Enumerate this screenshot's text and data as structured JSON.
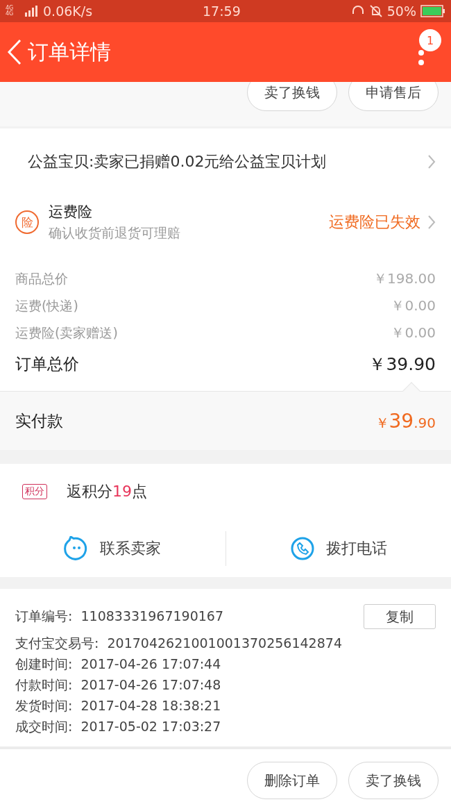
{
  "status_bar": {
    "network": "4G 4G",
    "speed": "0.06K/s",
    "time": "17:59",
    "battery": "50%"
  },
  "header": {
    "title": "订单详情",
    "badge": "1"
  },
  "top_actions": [
    "卖了换钱",
    "申请售后"
  ],
  "charity": {
    "text": "公益宝贝:卖家已捐赠0.02元给公益宝贝计划"
  },
  "insurance": {
    "icon_text": "险",
    "title": "运费险",
    "subtitle": "确认收货前退货可理赔",
    "status": "运费险已失效"
  },
  "prices": [
    {
      "label": "商品总价",
      "value": "￥198.00",
      "kind": "minor"
    },
    {
      "label": "运费(快递)",
      "value": "￥0.00",
      "kind": "minor"
    },
    {
      "label": "运费险(卖家赠送)",
      "value": "￥0.00",
      "kind": "minor"
    },
    {
      "label": "订单总价",
      "value": "￥39.90",
      "kind": "total"
    }
  ],
  "paid": {
    "label": "实付款",
    "currency": "￥",
    "integer": "39",
    "decimal": ".90"
  },
  "points": {
    "tag": "积分",
    "text": "返积分**19**点"
  },
  "contacts": [
    {
      "label": "联系卖家",
      "kind": "chat"
    },
    {
      "label": "拨打电话",
      "kind": "phone"
    }
  ],
  "order_info": [
    {
      "label": "订单编号:",
      "value": "11083331967190167",
      "copy": "复制"
    },
    {
      "label": "支付宝交易号:",
      "value": "2017042621001001370256142874"
    },
    {
      "label": "创建时间:",
      "value": "2017-04-26 17:07:44"
    },
    {
      "label": "付款时间:",
      "value": "2017-04-26 17:07:48"
    },
    {
      "label": "发货时间:",
      "value": "2017-04-28 18:38:21"
    },
    {
      "label": "成交时间:",
      "value": "2017-05-02 17:03:27"
    }
  ],
  "bottom_actions": [
    "删除订单",
    "卖了换钱"
  ]
}
